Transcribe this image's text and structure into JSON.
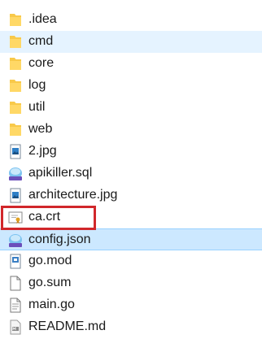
{
  "files": [
    {
      "name": ".idea",
      "icon": "folder-icon",
      "state": "normal"
    },
    {
      "name": "cmd",
      "icon": "folder-icon",
      "state": "hover"
    },
    {
      "name": "core",
      "icon": "folder-icon",
      "state": "normal"
    },
    {
      "name": "log",
      "icon": "folder-icon",
      "state": "normal"
    },
    {
      "name": "util",
      "icon": "folder-icon",
      "state": "normal"
    },
    {
      "name": "web",
      "icon": "folder-icon",
      "state": "normal"
    },
    {
      "name": "2.jpg",
      "icon": "image-file-icon",
      "state": "normal"
    },
    {
      "name": "apikiller.sql",
      "icon": "sql-preview-icon",
      "state": "normal"
    },
    {
      "name": "architecture.jpg",
      "icon": "image-file-icon",
      "state": "normal"
    },
    {
      "name": "ca.crt",
      "icon": "certificate-file-icon",
      "state": "annotated"
    },
    {
      "name": "config.json",
      "icon": "json-preview-icon",
      "state": "selected"
    },
    {
      "name": "go.mod",
      "icon": "go-mod-file-icon",
      "state": "normal"
    },
    {
      "name": "go.sum",
      "icon": "blank-file-icon",
      "state": "normal"
    },
    {
      "name": "main.go",
      "icon": "text-file-icon",
      "state": "normal"
    },
    {
      "name": "README.md",
      "icon": "markdown-file-icon",
      "state": "normal"
    }
  ],
  "colors": {
    "hover_background": "#e5f3ff",
    "selected_background": "#cce8ff",
    "selected_border": "#99d1ff",
    "annotation_border": "#d1272b",
    "folder_yellow": "#f8c94a"
  }
}
